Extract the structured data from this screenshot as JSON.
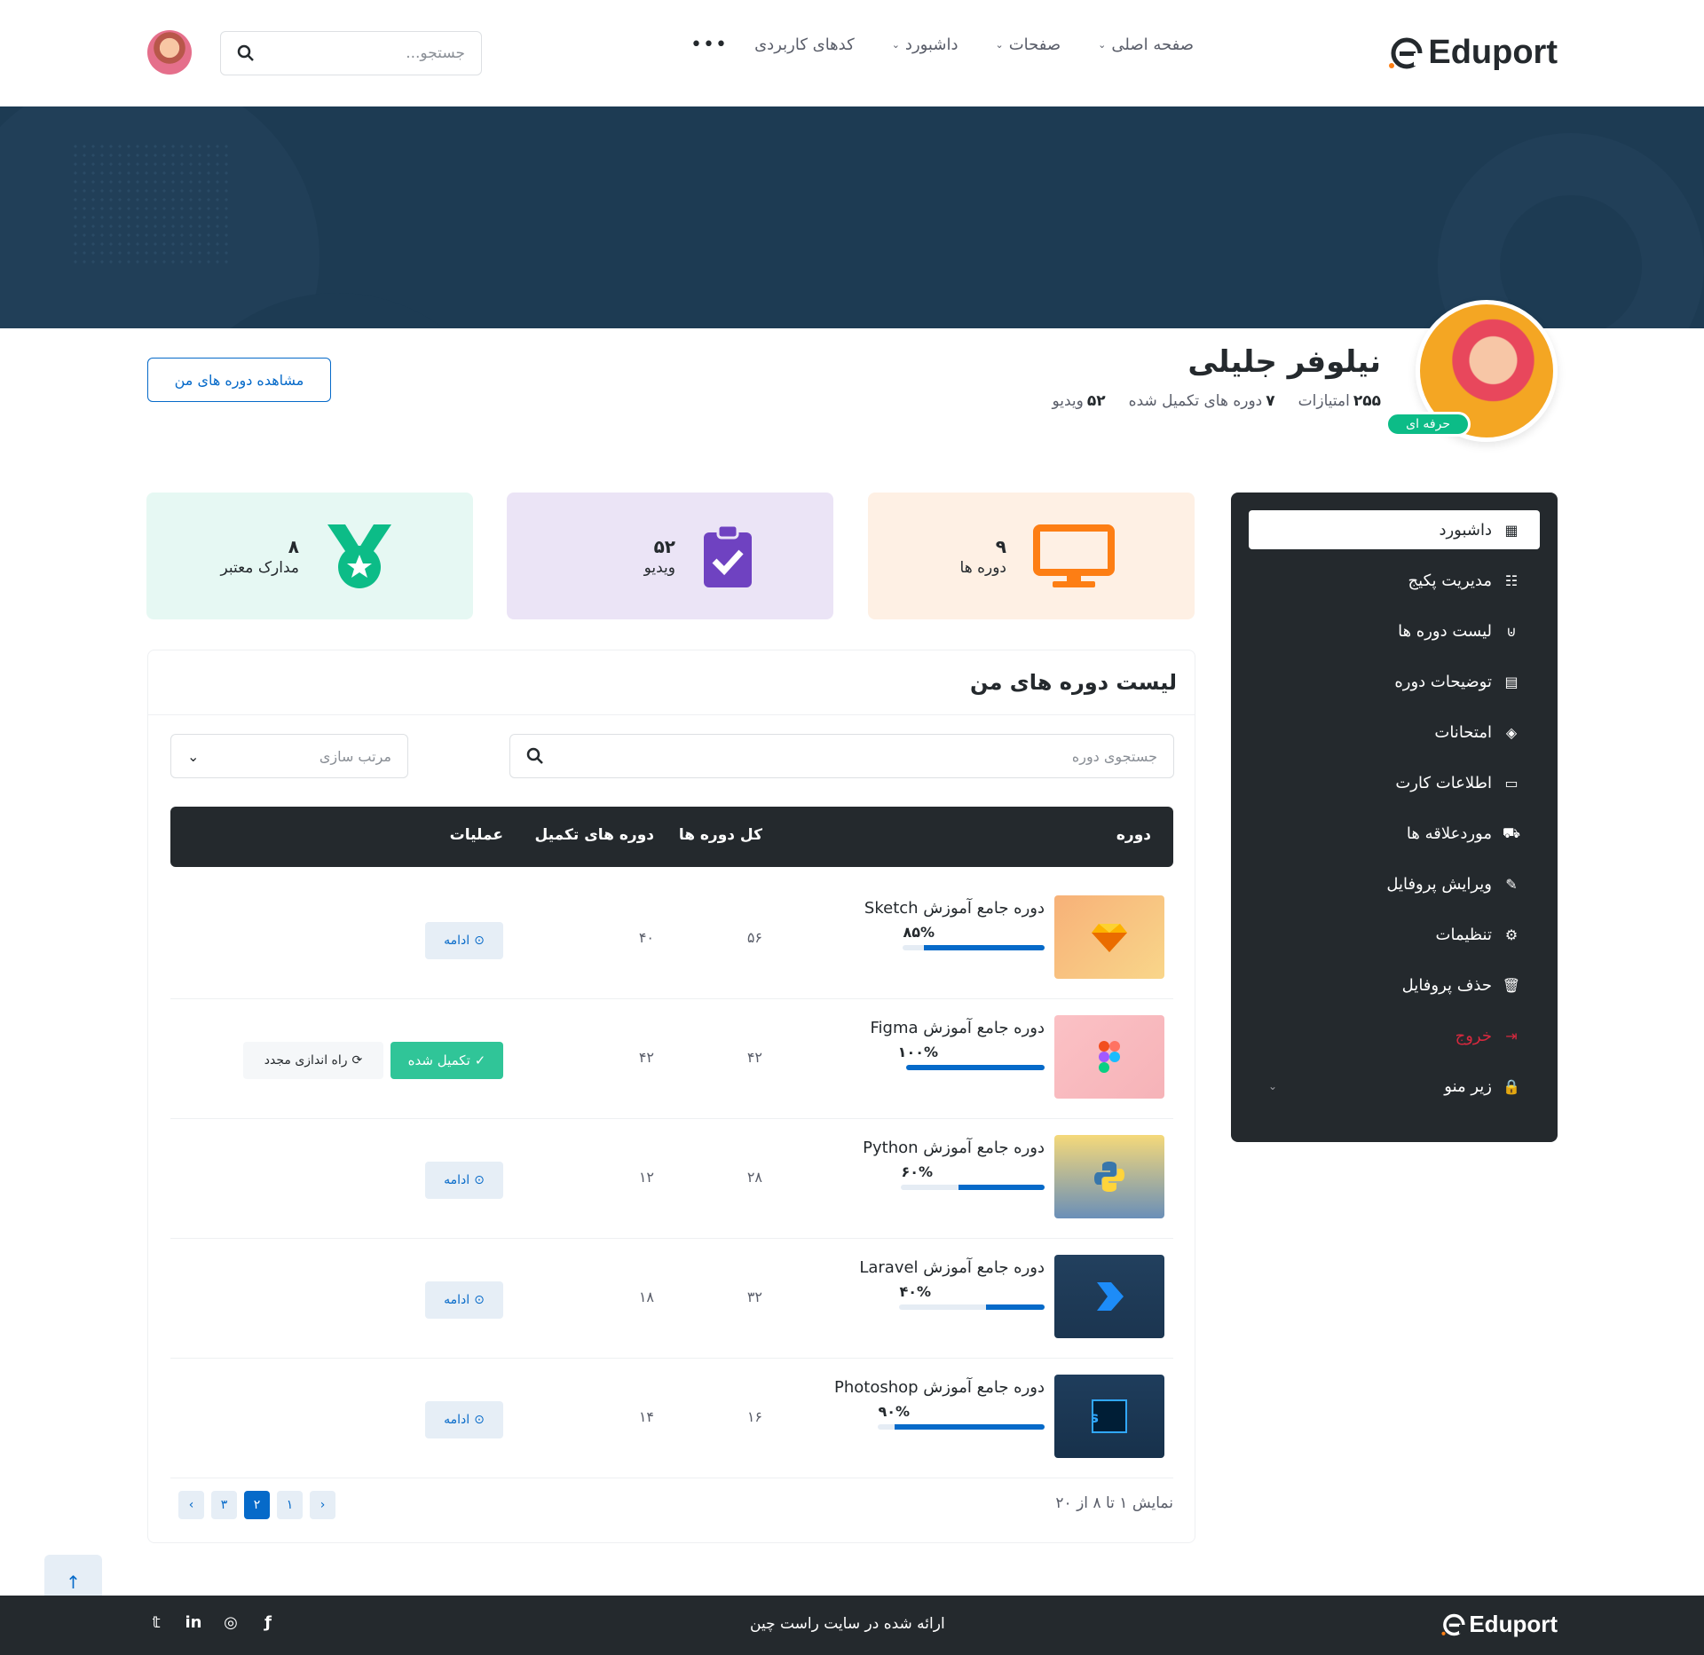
{
  "header": {
    "logo": "Eduport",
    "nav": [
      {
        "label": "صفحه اصلی",
        "dropdown": true
      },
      {
        "label": "صفحات",
        "dropdown": true
      },
      {
        "label": "داشبورد",
        "dropdown": true
      },
      {
        "label": "کدهای کاربردی",
        "dropdown": false
      }
    ],
    "more_label": "•••",
    "search_placeholder": "جستجو...",
    "brand_color": "#fd7e14"
  },
  "profile": {
    "name": "نیلوفر جلیلی",
    "badge": "حرفه ای",
    "stats": [
      {
        "value": "۲۵۵",
        "label": "امتیازات"
      },
      {
        "value": "۷",
        "label": "دوره های تکمیل شده"
      },
      {
        "value": "۵۲",
        "label": "ویدیو"
      }
    ],
    "my_courses_button": "مشاهده دوره های من"
  },
  "sidebar": {
    "items": [
      {
        "label": "داشبورد",
        "icon": "grid-icon",
        "glyph": "▦",
        "active": true
      },
      {
        "label": "مدیریت پکیج",
        "icon": "card-list-icon",
        "glyph": "☷"
      },
      {
        "label": "لیست دوره ها",
        "icon": "basket-icon",
        "glyph": "⊍"
      },
      {
        "label": "توضیحات دوره",
        "icon": "file-text-icon",
        "glyph": "▤"
      },
      {
        "label": "امتحانات",
        "icon": "patch-question-icon",
        "glyph": "◈"
      },
      {
        "label": "اطلاعات کارت",
        "icon": "credit-card-icon",
        "glyph": "▭"
      },
      {
        "label": "موردعلاقه ها",
        "icon": "cart-icon",
        "glyph": "⛟"
      },
      {
        "label": "ویرایش پروفایل",
        "icon": "pencil-square-icon",
        "glyph": "✎"
      },
      {
        "label": "تنظیمات",
        "icon": "gear-icon",
        "glyph": "⚙"
      },
      {
        "label": "حذف پروفایل",
        "icon": "trash-icon",
        "glyph": "🗑"
      },
      {
        "label": "خروج",
        "icon": "sign-out-icon",
        "glyph": "⇥",
        "danger": true
      },
      {
        "label": "زیر منو",
        "icon": "lock-icon",
        "glyph": "🔒",
        "submenu": true
      }
    ]
  },
  "stat_cards": [
    {
      "value": "۹",
      "label": "دوره ها",
      "icon": "tv-icon",
      "color": "#fd7e14"
    },
    {
      "value": "۵۲",
      "label": "ویدیو",
      "icon": "clipboard-check-icon",
      "color": "#6f42c1"
    },
    {
      "value": "۸",
      "label": "مدارک معتبر",
      "icon": "medal-icon",
      "color": "#0cbc87"
    }
  ],
  "course_list": {
    "title": "لیست دوره های من",
    "search_placeholder": "جستجوی دوره",
    "sort_placeholder": "مرتب سازی",
    "columns": [
      "دوره",
      "کل دوره ها",
      "دوره های تکمیل",
      "عملیات"
    ],
    "rows": [
      {
        "title": "دوره جامع آموزش Sketch",
        "percent": "۸۵%",
        "progress": 0.85,
        "total": "۵۶",
        "done": "۴۰",
        "action": "ادامه",
        "thumb": "sketch-logo"
      },
      {
        "title": "دوره جامع آموزش Figma",
        "percent": "۱۰۰%",
        "progress": 1.0,
        "total": "۴۲",
        "done": "۴۲",
        "action": "تکمیل شده",
        "restart": "راه اندازی مجدد",
        "thumb": "figma-logo"
      },
      {
        "title": "دوره جامع آموزش Python",
        "percent": "۶۰%",
        "progress": 0.6,
        "total": "۲۸",
        "done": "۱۲",
        "action": "ادامه",
        "thumb": "python-logo"
      },
      {
        "title": "دوره جامع آموزش Laravel",
        "percent": "۴۰%",
        "progress": 0.4,
        "total": "۳۲",
        "done": "۱۸",
        "action": "ادامه",
        "thumb": "laravel-logo"
      },
      {
        "title": "دوره جامع آموزش Photoshop",
        "percent": "۹۰%",
        "progress": 0.9,
        "total": "۱۶",
        "done": "۱۴",
        "action": "ادامه",
        "thumb": "photoshop-logo"
      }
    ],
    "pagination": {
      "info": "نمایش ۱ تا ۸ از ۲۰",
      "pages": [
        "۱",
        "۲",
        "۳"
      ],
      "current": "۲"
    }
  },
  "footer": {
    "logo": "Eduport",
    "text": "ارائه شده در سایت راست چین",
    "social": [
      "facebook-icon",
      "instagram-icon",
      "linkedin-icon",
      "twitter-icon"
    ]
  }
}
